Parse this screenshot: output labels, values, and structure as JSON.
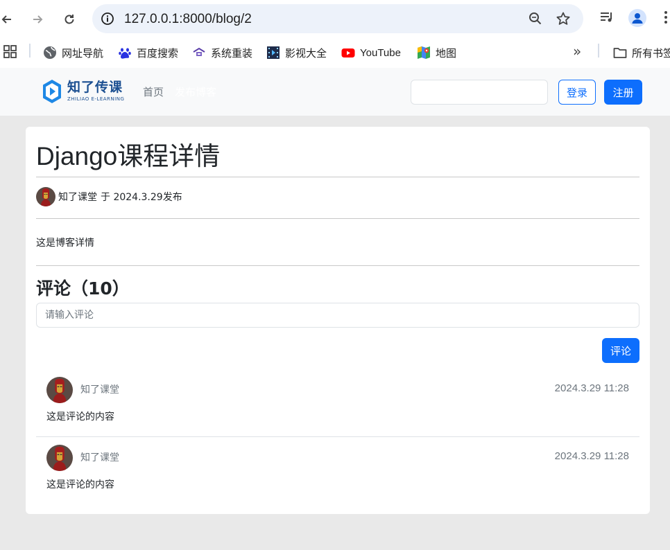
{
  "browser": {
    "url": "127.0.0.1:8000/blog/2",
    "bookmarks": [
      {
        "label": "网址导航",
        "icon": "globe-icon"
      },
      {
        "label": "百度搜索",
        "icon": "baidu-paw-icon"
      },
      {
        "label": "系统重装",
        "icon": "system-icon"
      },
      {
        "label": "影视大全",
        "icon": "film-icon"
      },
      {
        "label": "YouTube",
        "icon": "youtube-icon"
      },
      {
        "label": "地图",
        "icon": "maps-icon"
      }
    ],
    "bookmarks_folder": "所有书签"
  },
  "navbar": {
    "logo_main": "知了传课",
    "logo_sub": "ZHILIAO E-LEARNING",
    "links": [
      "首页",
      "发布博客"
    ],
    "search_value": "",
    "login_label": "登录",
    "register_label": "注册"
  },
  "blog": {
    "title": "Django课程详情",
    "author": "知了课堂",
    "published": "于 2024.3.29发布",
    "content": "这是博客详情"
  },
  "comments_section": {
    "heading": "评论（10）",
    "input_placeholder": "请输入评论",
    "submit_label": "评论",
    "items": [
      {
        "user": "知了课堂",
        "time": "2024.3.29 11:28",
        "text": "这是评论的内容"
      },
      {
        "user": "知了课堂",
        "time": "2024.3.29 11:28",
        "text": "这是评论的内容"
      }
    ]
  },
  "colors": {
    "primary": "#0d6efd",
    "navbar_bg": "#f8f9fa",
    "page_bg": "#e9e9e9",
    "logo": "#1b4f91"
  }
}
